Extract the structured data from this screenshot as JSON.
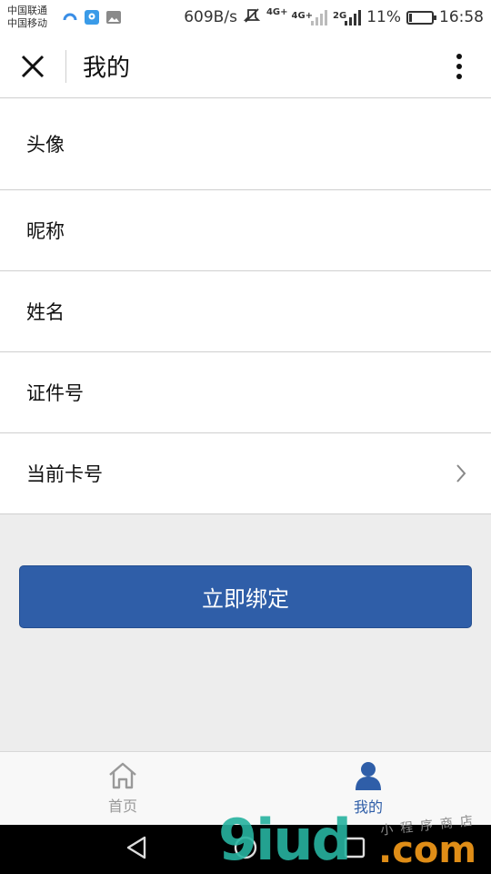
{
  "status_bar": {
    "carrier_1": "中国联通",
    "carrier_2": "中国移动",
    "speed": "609B/s",
    "net_1": "4G+",
    "net_2": "4G+",
    "net_3": "2G",
    "battery": "11%",
    "battery_level": 0.11,
    "time": "16:58"
  },
  "header": {
    "title": "我的",
    "close_icon": "close-icon",
    "more_icon": "more-vertical-icon"
  },
  "form": {
    "rows": [
      {
        "label": "头像"
      },
      {
        "label": "昵称"
      },
      {
        "label": "姓名"
      },
      {
        "label": "证件号"
      },
      {
        "label": "当前卡号",
        "icon": "chevron-right-icon"
      }
    ]
  },
  "bind_button": {
    "label": "立即绑定"
  },
  "tabbar": {
    "tabs": [
      {
        "label": "首页",
        "icon": "home-icon",
        "active": false
      },
      {
        "label": "我的",
        "icon": "user-icon",
        "active": true
      }
    ]
  },
  "watermark": {
    "main": "9iud",
    "com": ".com",
    "sub": "小程序商店"
  },
  "colors": {
    "accent": "#2f5ea8",
    "background": "#ededed",
    "divider": "#cfcfcf"
  }
}
